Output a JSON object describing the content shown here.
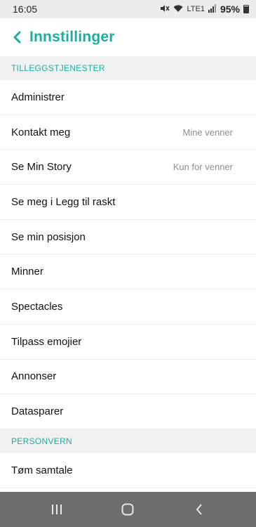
{
  "status": {
    "time": "16:05",
    "battery": "95%",
    "network": "LTE1"
  },
  "header": {
    "title": "Innstillinger"
  },
  "sections": [
    {
      "title": "TILLEGGSTJENESTER",
      "items": [
        {
          "label": "Administrer",
          "value": ""
        },
        {
          "label": "Kontakt meg",
          "value": "Mine venner"
        },
        {
          "label": "Se Min Story",
          "value": "Kun for venner"
        },
        {
          "label": "Se meg i Legg til raskt",
          "value": ""
        },
        {
          "label": "Se min posisjon",
          "value": ""
        },
        {
          "label": "Minner",
          "value": ""
        },
        {
          "label": "Spectacles",
          "value": ""
        },
        {
          "label": "Tilpass emojier",
          "value": ""
        },
        {
          "label": "Annonser",
          "value": ""
        },
        {
          "label": "Datasparer",
          "value": ""
        }
      ]
    },
    {
      "title": "PERSONVERN",
      "items": [
        {
          "label": "Tøm samtale",
          "value": ""
        }
      ]
    }
  ],
  "colors": {
    "accent": "#1aae9f",
    "section_bg": "#f1f1f1",
    "nav_bg": "#6d6d6d"
  }
}
